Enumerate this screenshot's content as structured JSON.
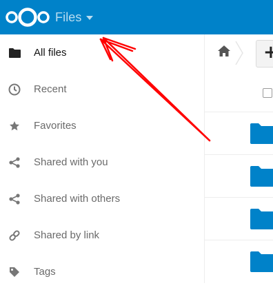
{
  "header": {
    "app_title": "Files",
    "brand_color": "#0082c9"
  },
  "sidebar": {
    "items": [
      {
        "label": "All files",
        "icon": "folder-icon",
        "active": true
      },
      {
        "label": "Recent",
        "icon": "clock-icon",
        "active": false
      },
      {
        "label": "Favorites",
        "icon": "star-icon",
        "active": false
      },
      {
        "label": "Shared with you",
        "icon": "share-icon",
        "active": false
      },
      {
        "label": "Shared with others",
        "icon": "share-icon",
        "active": false
      },
      {
        "label": "Shared by link",
        "icon": "link-icon",
        "active": false
      },
      {
        "label": "Tags",
        "icon": "tag-icon",
        "active": false
      }
    ]
  },
  "content": {
    "new_button_label": "+",
    "folder_color": "#0082c9"
  },
  "annotation": {
    "arrow_color": "#ff0000"
  }
}
